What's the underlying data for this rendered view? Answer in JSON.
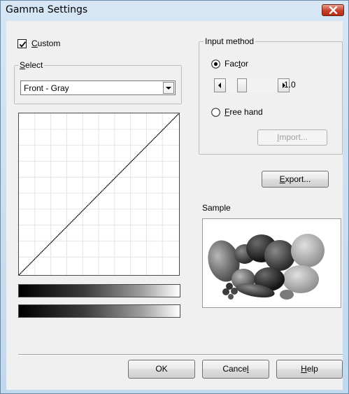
{
  "window": {
    "title": "Gamma Settings"
  },
  "custom": {
    "label": "Custom",
    "accel": "C",
    "checked": true
  },
  "select_group": {
    "caption": "Select",
    "accel": "S",
    "value": "Front - Gray"
  },
  "input_method": {
    "caption": "Input method",
    "factor_label_a": "Fac",
    "factor_accel": "t",
    "factor_label_b": "or",
    "factor_selected": true,
    "factor_value": "1.0",
    "slider_level": 0.27,
    "freehand_label_accel": "F",
    "freehand_label_rest": "ree hand",
    "freehand_selected": false,
    "import_accel": "I",
    "import_rest": "mport...",
    "import_enabled": false
  },
  "export": {
    "accel": "E",
    "rest": "xport..."
  },
  "sample": {
    "label": "Sample"
  },
  "gamma_curve": {
    "type": "line",
    "points": [
      [
        0,
        0
      ],
      [
        1,
        1
      ]
    ],
    "grid": true
  },
  "buttons": {
    "ok": "OK",
    "cancel_a": "Cance",
    "cancel_accel": "l",
    "help_accel": "H",
    "help_rest": "elp"
  },
  "colors": {
    "title_close_red": "#c5402a",
    "dialog_bg": "#f0f0f0",
    "frame_blue": "#c6dcee"
  },
  "icons": {
    "close": "close-x-icon",
    "check": "checkmark-icon",
    "dropdown": "chevron-down-icon",
    "left": "arrow-left-icon",
    "right": "arrow-right-icon"
  }
}
